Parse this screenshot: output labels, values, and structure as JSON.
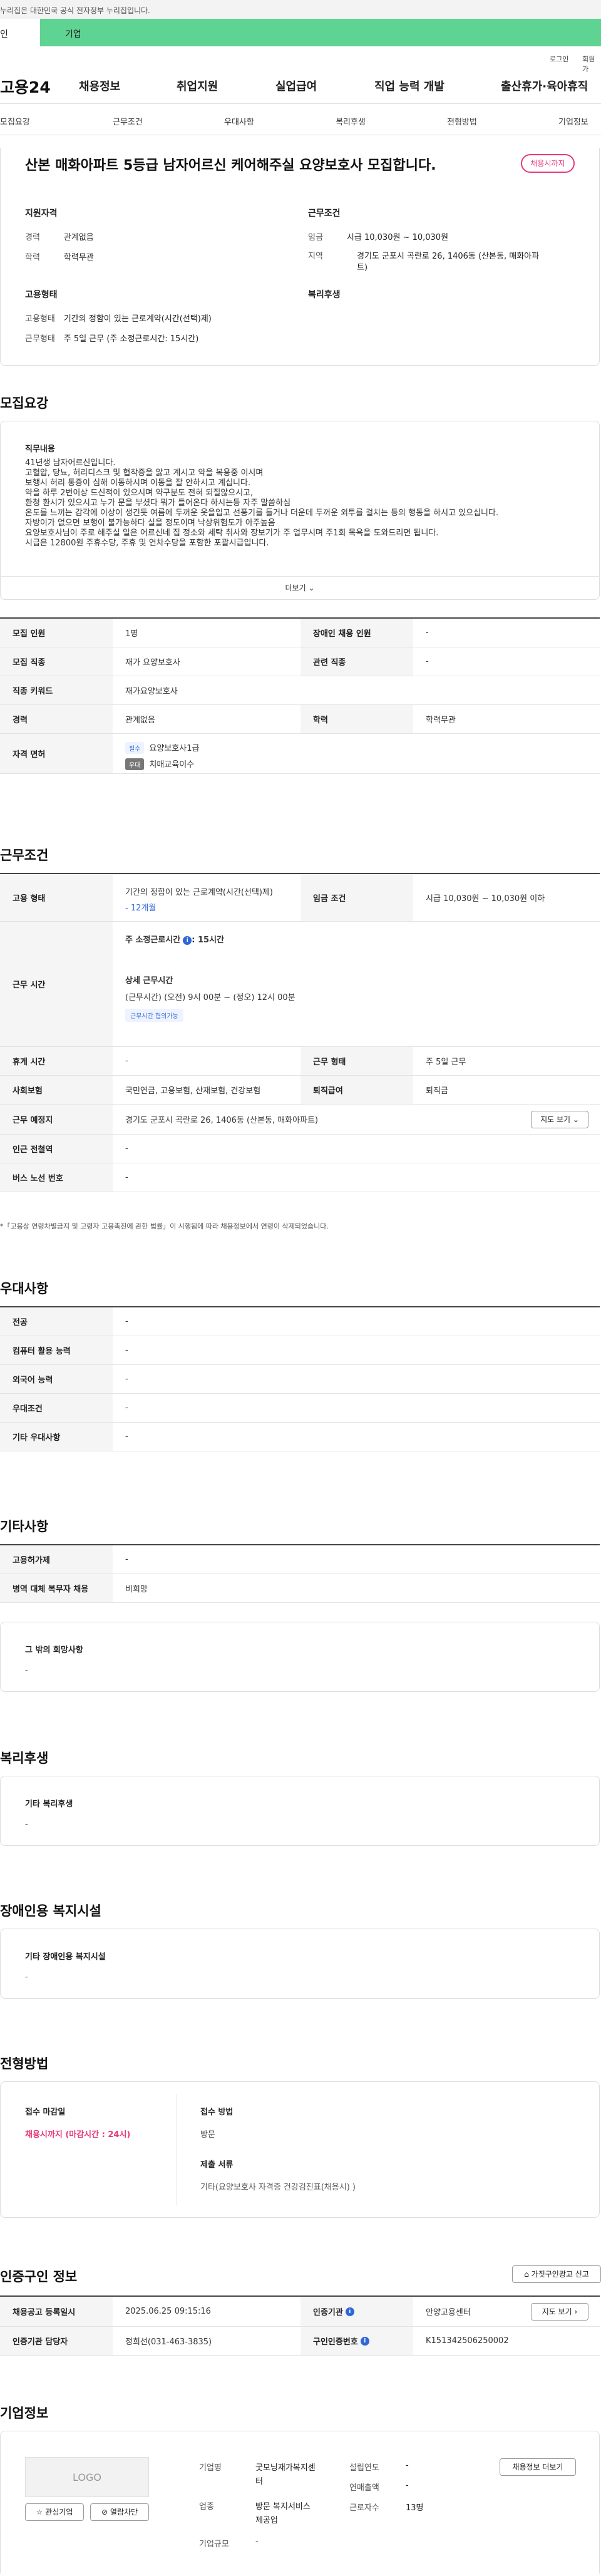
{
  "gov_banner": "누리집은 대한민국 공식 전자정부 누리집입니다.",
  "user_tabs": [
    "인",
    "기업"
  ],
  "util": {
    "login": "로그인",
    "join": "회원가"
  },
  "gnb": {
    "logo": "고용24",
    "items": [
      "채용정보",
      "취업지원",
      "실업급여",
      "직업 능력 개발",
      "출산휴가·육아휴직"
    ]
  },
  "subnav": [
    "모집요강",
    "근무조건",
    "우대사항",
    "복리후생",
    "전형방법",
    "기업정보"
  ],
  "header": {
    "title": "산본 매화아파트 5등급 남자어르신 케어해주실 요양보호사 모집합니다.",
    "status": "채용시까지",
    "qual_title": "지원자격",
    "cond_title": "근무조건",
    "type_title": "고용형태",
    "welfare_title": "복리후생",
    "career_label": "경력",
    "career_value": "관계없음",
    "edu_label": "학력",
    "edu_value": "학력무관",
    "wage_label": "임금",
    "wage_value": "시급 10,030원 ~ 10,030원",
    "area_label": "지역",
    "area_value_1": "경기도 군포시 곡란로 26, 1406동 (산본동, 매화아파",
    "area_value_2": "트)",
    "emp_type_label": "고용형태",
    "emp_type_value": "기간의 정함이 있는 근로계약(시간(선택)제)",
    "workday_label": "근무형태",
    "workday_value": "주 5일 근무 (주 소정근로시간: 15시간)"
  },
  "recruit": {
    "section_title": "모집요강",
    "duty_title": "직무내용",
    "description": "41년생 남자어르신입니다.\n 고혈압, 당뇨, 허리디스크 및 협착증을 앓고 계시고 약을 복용중 이시며\n 보행시 허리 통증이 심해 이동하시며 이동을 잘 안하시고 계십니다.\n 약을 하루 2번이상 드신적이 있으시며 약구분도 전혀 되질않으시고,\n 환청 환시가 있으시고 누가 문을 부셨다 뭐가 들어온다 하시는등 자주 말씀하심\n 온도를 느끼는 감각에 이상이 생긴듯 여름에 두꺼운 옷을입고 선풍기를 틀거나 더운데 두꺼운 외투를 걸치는 등의 행동을 하시고 있으십니다.\n 자방이가 없으면 보행이 불가능하다 실을 정도이며 낙상위험도가 아주높음\n 요양보호사님이 주로 해주실 일은 어르신네 집 정소와 세탁 취사와 장보기가 주 업무시며 주1회 목욕을 도와드리면 됩니다.\n 시급은 12800원 주휴수당, 주휴 및 연차수당을 포함한 포괄시급입니다.",
    "more": "더보기",
    "rows": [
      {
        "k1": "모집 인원",
        "v1": "1명",
        "k2": "장애인 채용 인원",
        "v2": "-"
      },
      {
        "k1": "모집 직종",
        "v1": "재가 요양보호사",
        "k2": "관련 직종",
        "v2": "-"
      },
      {
        "k1": "직종 키워드",
        "v1": "재가요양보호사"
      },
      {
        "k1": "경력",
        "v1": "관계없음",
        "k2": "학력",
        "v2": "학력무관"
      }
    ],
    "license_label": "자격 면허",
    "license_required_badge": "필수",
    "license_required": "요양보호사1급",
    "license_alt_badge": "우대",
    "license_alt": "치매교육이수"
  },
  "conditions": {
    "section_title": "근무조건",
    "emp_type_label": "고용 형태",
    "emp_type_value": "기간의 정함이 있는 근로계약(시간(선택)제)",
    "emp_period": "- 12개월",
    "wage_label": "임금 조건",
    "wage_value": "시급 10,030원 ~ 10,030원 이하",
    "hours_label": "근무 시간",
    "weekly_hours": "주 소정근로시간",
    "weekly_hours_value": ": 15시간",
    "detail_title": "상세 근무시간",
    "detail_value": "(근무시간) (오전) 9시 00분 ~ (정오) 12시 00분",
    "detail_chip": "근무시간 협의가능",
    "rest_label": "휴게 시간",
    "rest_value": "-",
    "workform_label": "근무 형태",
    "workform_value": "주 5일 근무",
    "insurance_label": "사회보험",
    "insurance_value": "국민연금, 고용보험, 산재보험, 건강보험",
    "severance_label": "퇴직급여",
    "severance_value": "퇴직금",
    "place_label": "근무 예정지",
    "place_value": "경기도 군포시 곡란로 26, 1406동 (산본동, 매화아파트)",
    "map_button": "지도 보기",
    "station_label": "인근 전철역",
    "station_value": "-",
    "bus_label": "버스 노선 번호",
    "bus_value": "-",
    "note": "*「고용상 연령차별금지 및 고령자 고용촉진에 관한 법률」이 시행됨에 따라 채용정보에서 연령이 삭제되었습니다."
  },
  "preferences": {
    "section_title": "우대사항",
    "rows": [
      {
        "k": "전공",
        "v": "-"
      },
      {
        "k": "컴퓨터 활용 능력",
        "v": "-"
      },
      {
        "k": "외국어 능력",
        "v": "-"
      },
      {
        "k": "우대조건",
        "v": "-"
      },
      {
        "k": "기타 우대사항",
        "v": "-"
      }
    ]
  },
  "etc": {
    "section_title": "기타사항",
    "rows": [
      {
        "k": "고용허가제",
        "v": "-"
      },
      {
        "k": "병역 대체 복무자 채용",
        "v": "비희망"
      }
    ],
    "other_title": "그 밖의 희망사항",
    "other_value": "-"
  },
  "welfare": {
    "section_title": "복리후생",
    "box_title": "기타 복리후생",
    "box_value": "-"
  },
  "facility": {
    "section_title": "장애인용 복지시설",
    "box_title": "기타 장애인용 복지시설",
    "box_value": "-"
  },
  "process": {
    "section_title": "전형방법",
    "deadline_title": "접수 마감일",
    "deadline_value": "채용시까지 (마감시간 : 24시)",
    "method_title": "접수 방법",
    "method_value": "방문",
    "docs_title": "제출 서류",
    "docs_value": "기타(요양보호사 자격증 건강검진표(채용시) )"
  },
  "cert": {
    "section_title": "인증구인 정보",
    "top_button": "가짓구인광고 신고",
    "reg_label": "채용공고 등록일시",
    "reg_value": "2025.06.25 09:15:16",
    "org_label": "인증기관",
    "org_value": "안양고용센터",
    "manager_label": "인증기관 담당자",
    "manager_value": "정희선(031-463-3835)",
    "number_label": "구인인증번호",
    "number_value": "K151342506250002",
    "map_button": "지도 보기"
  },
  "company": {
    "section_title": "기업정보",
    "logo_text": "LOGO",
    "fav_button": "관심기업",
    "block_button": "열람차단",
    "name_label": "기업명",
    "name_value_1": "굿모닝재가복지센",
    "name_value_2": "터",
    "industry_label": "업종",
    "industry_value_1": "방문 복지서비스",
    "industry_value_2": "제공업",
    "size_label": "기업규모",
    "size_value": "-",
    "founded_label": "설립연도",
    "founded_value": "-",
    "revenue_label": "연매출액",
    "revenue_value": "-",
    "employees_label": "근로자수",
    "employees_value": "13명",
    "jobs_button": "채용정보 더보기"
  },
  "colors": {
    "accent_green": "#5fd391",
    "status_pink": "#e73a7a",
    "link_blue": "#2f67d6"
  }
}
